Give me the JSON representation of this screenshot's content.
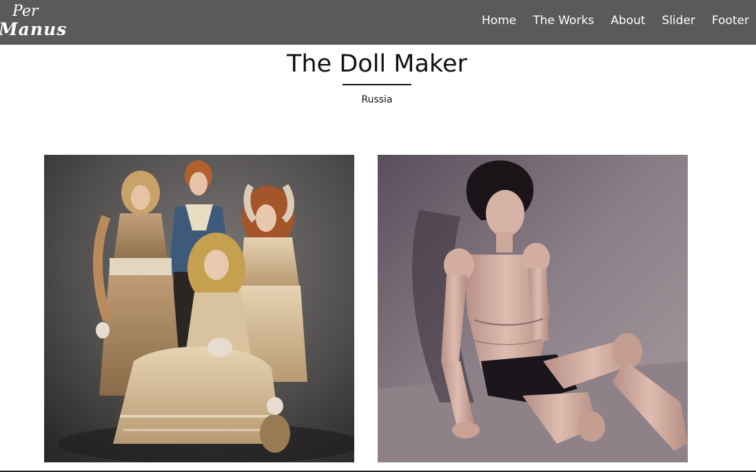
{
  "header": {
    "logo": {
      "line1": "Per",
      "line2": "Manus"
    },
    "nav": [
      "Home",
      "The Works",
      "About",
      "Slider",
      "Footer"
    ]
  },
  "main": {
    "title": "The Doll Maker",
    "subtitle": "Russia"
  },
  "gallery": [
    {
      "subject": "group of four Victorian-dressed dolls"
    },
    {
      "subject": "jointed male ball-jointed doll seated against wall"
    }
  ],
  "colors": {
    "header_bg": "#5b5a5b",
    "nav_text": "#ffffff",
    "title_text": "#111111"
  }
}
